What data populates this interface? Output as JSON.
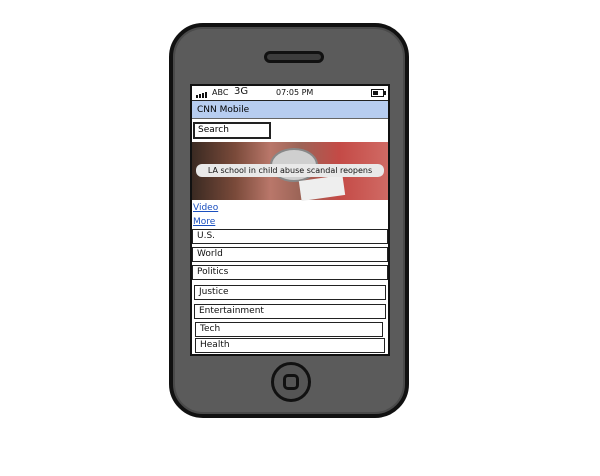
{
  "status_bar": {
    "carrier": "ABC",
    "network": "3G",
    "time": "07:05 PM"
  },
  "title_bar": {
    "title": "CNN Mobile"
  },
  "search": {
    "label": "Search"
  },
  "hero": {
    "caption": "LA school in child abuse scandal reopens"
  },
  "links": {
    "video": "Video",
    "more": "More"
  },
  "categories": [
    "U.S.",
    "World",
    "Politics",
    "Justice",
    "Entertainment",
    "Tech",
    "Health"
  ],
  "battery_level": 0.6
}
